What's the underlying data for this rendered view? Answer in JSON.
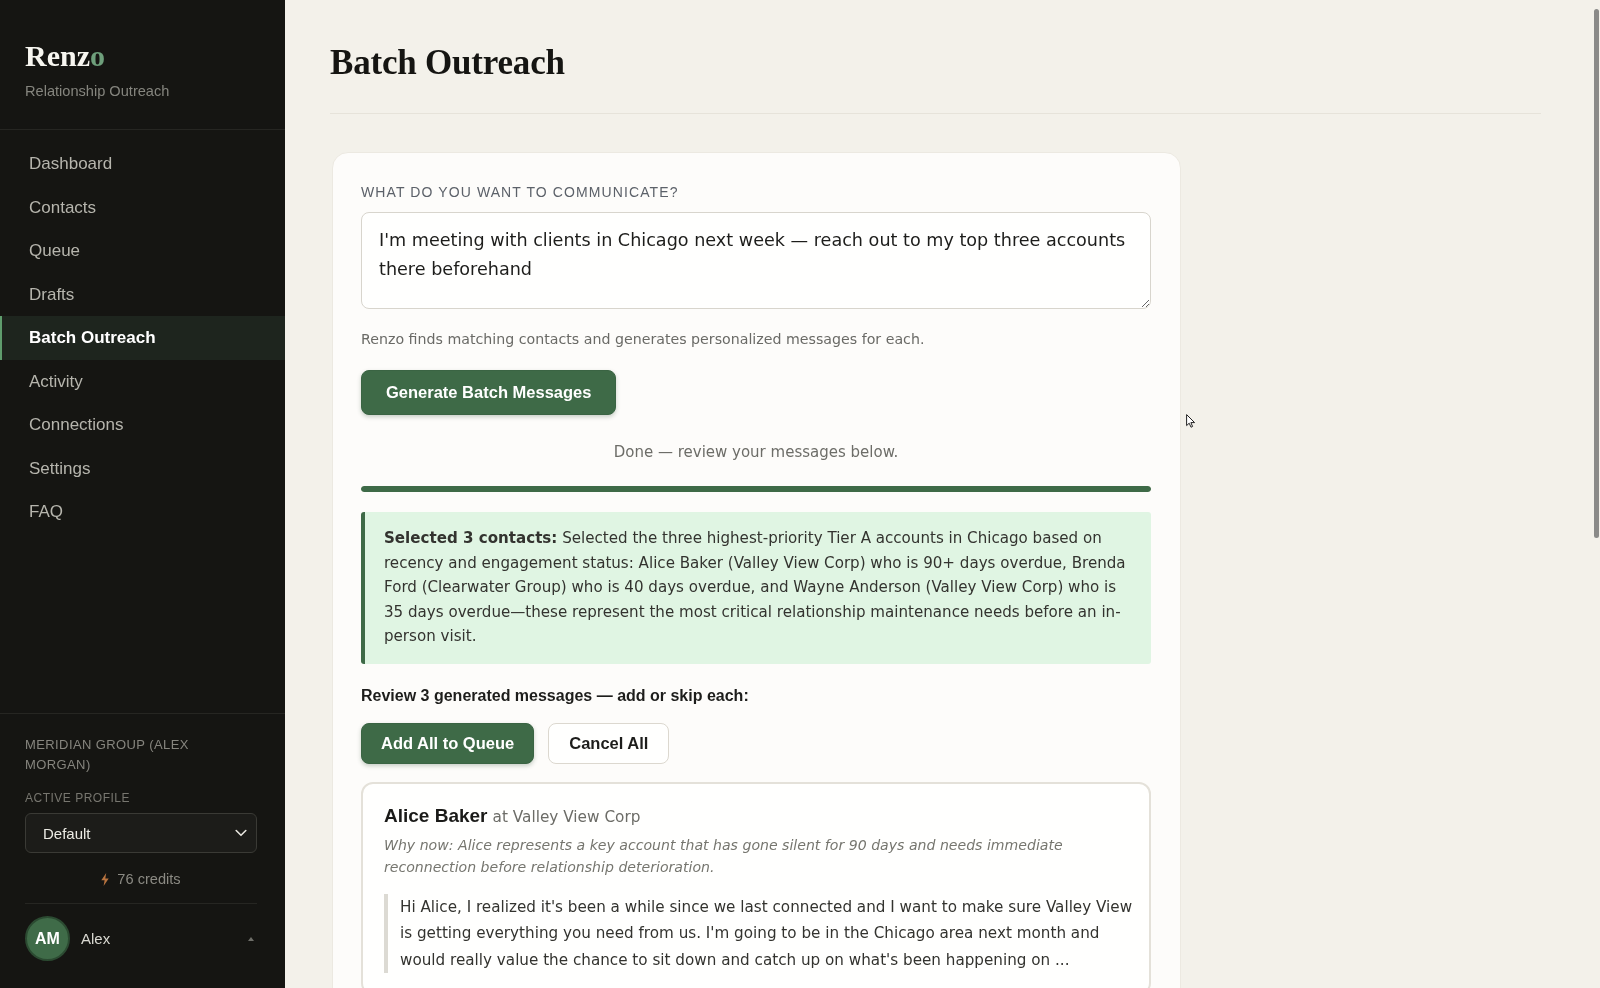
{
  "sidebar": {
    "logo": {
      "text": "Renz",
      "accent": "o"
    },
    "subtitle": "Relationship Outreach",
    "nav": [
      {
        "label": "Dashboard",
        "selected": false
      },
      {
        "label": "Contacts",
        "selected": false
      },
      {
        "label": "Queue",
        "selected": false
      },
      {
        "label": "Drafts",
        "selected": false
      },
      {
        "label": "Batch Outreach",
        "selected": true
      },
      {
        "label": "Activity",
        "selected": false
      },
      {
        "label": "Connections",
        "selected": false
      },
      {
        "label": "Settings",
        "selected": false
      },
      {
        "label": "FAQ",
        "selected": false
      }
    ],
    "org": "MERIDIAN GROUP (ALEX MORGAN)",
    "profile": {
      "label": "ACTIVE PROFILE",
      "value": "Default"
    },
    "credits": "76 credits",
    "user": {
      "initials": "AM",
      "name": "Alex"
    }
  },
  "page": {
    "title": "Batch Outreach"
  },
  "composer": {
    "label": "WHAT DO YOU WANT TO COMMUNICATE?",
    "value": "I'm meeting with clients in Chicago next week — reach out to my top three accounts there beforehand",
    "hint": "Renzo finds matching contacts and generates personalized messages for each.",
    "button": "Generate Batch Messages"
  },
  "progress": {
    "status": "Done — review your messages below.",
    "level": 1
  },
  "summary": "**Selected 3 contacts:** Selected the three highest-priority Tier A accounts in Chicago based on recency and engagement status: Alice Baker (Valley View Corp) who is 90+ days overdue, Brenda Ford (Clearwater Group) who is 40 days overdue, and Wayne Anderson (Valley View Corp) who is 35 days overdue—these represent the most critical relationship maintenance needs before an in-person visit.",
  "review": {
    "heading": "Review 3 generated messages — add or skip each:",
    "buttons": [
      {
        "label": "Add All to Queue",
        "kind": "primary"
      },
      {
        "label": "Cancel All",
        "kind": "secondary"
      }
    ]
  },
  "messages": [
    {
      "name": "Alice Baker",
      "affiliation": "at Valley View Corp",
      "why_now": "Why now: Alice represents a key account that has gone silent for 90 days and needs immediate reconnection before relationship deterioration.",
      "body": "Hi Alice, I realized it's been a while since we last connected and I want to make sure Valley View is getting everything you need from us. I'm going to be in the Chicago area next month and would really value the chance to sit down and catch up on what's been happening on ..."
    }
  ]
}
